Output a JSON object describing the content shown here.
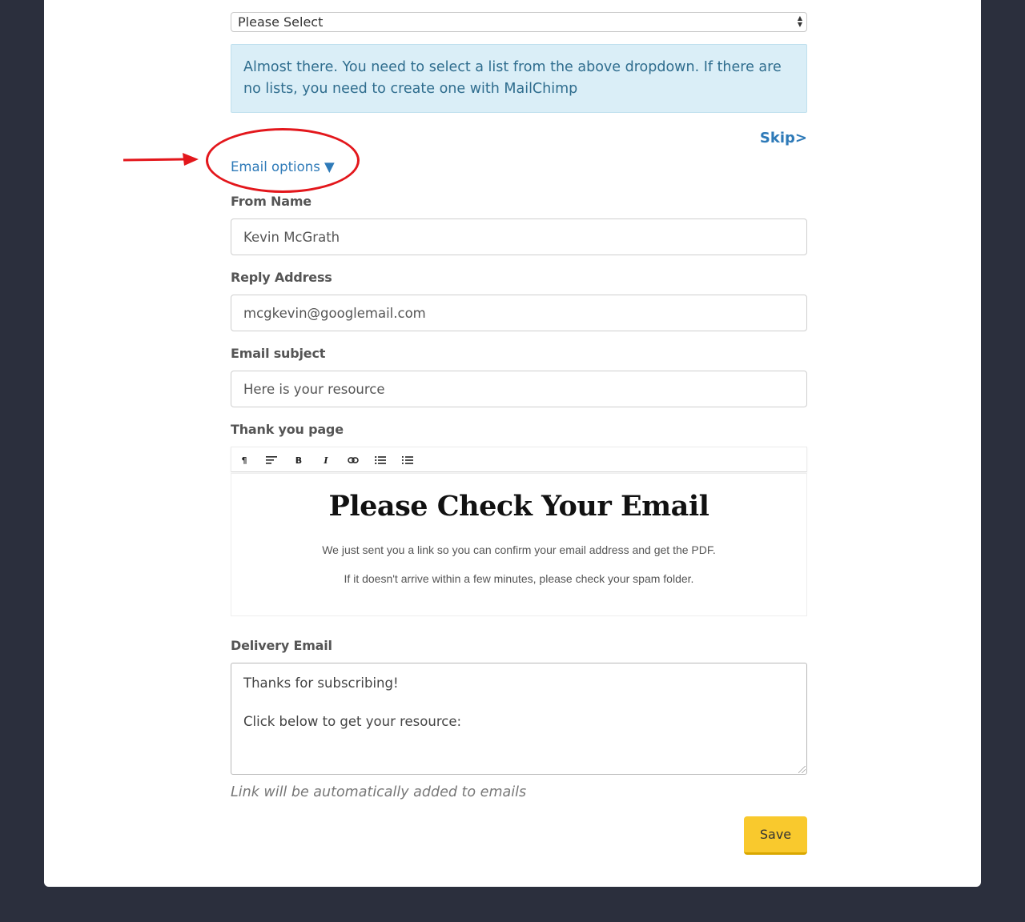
{
  "list_select": {
    "selected": "Please Select"
  },
  "alert": {
    "text": "Almost there. You need to select a list from the above dropdown. If there are no lists, you need to create one with MailChimp"
  },
  "skip_link": "Skip>",
  "email_options": {
    "label": "Email options",
    "toggle_glyph": "▼"
  },
  "form": {
    "from_name": {
      "label": "From Name",
      "value": "Kevin McGrath"
    },
    "reply_address": {
      "label": "Reply Address",
      "value": "mcgkevin@googlemail.com"
    },
    "email_subject": {
      "label": "Email subject",
      "value": "Here is your resource"
    },
    "thank_you_page": {
      "label": "Thank you page",
      "toolbar": [
        "paragraph-icon",
        "align-icon",
        "bold-icon",
        "italic-icon",
        "link-icon",
        "bullet-list-icon",
        "numbered-list-icon"
      ],
      "heading": "Please Check Your Email",
      "paragraph_1": "We just sent you a link so you can confirm your email address and get the PDF.",
      "paragraph_2": "If it doesn't arrive within a few minutes, please check your spam folder."
    },
    "delivery_email": {
      "label": "Delivery Email",
      "line_1": "Thanks for subscribing!",
      "line_2": "Click below to get your resource:"
    },
    "hint": "Link will be automatically added to emails",
    "save_label": "Save"
  },
  "colors": {
    "page_bg": "#2b2f3d",
    "accent_link": "#2e7ab8",
    "alert_bg": "#daeef7",
    "save_bg": "#f9c92d",
    "annotation": "#e3171c"
  }
}
